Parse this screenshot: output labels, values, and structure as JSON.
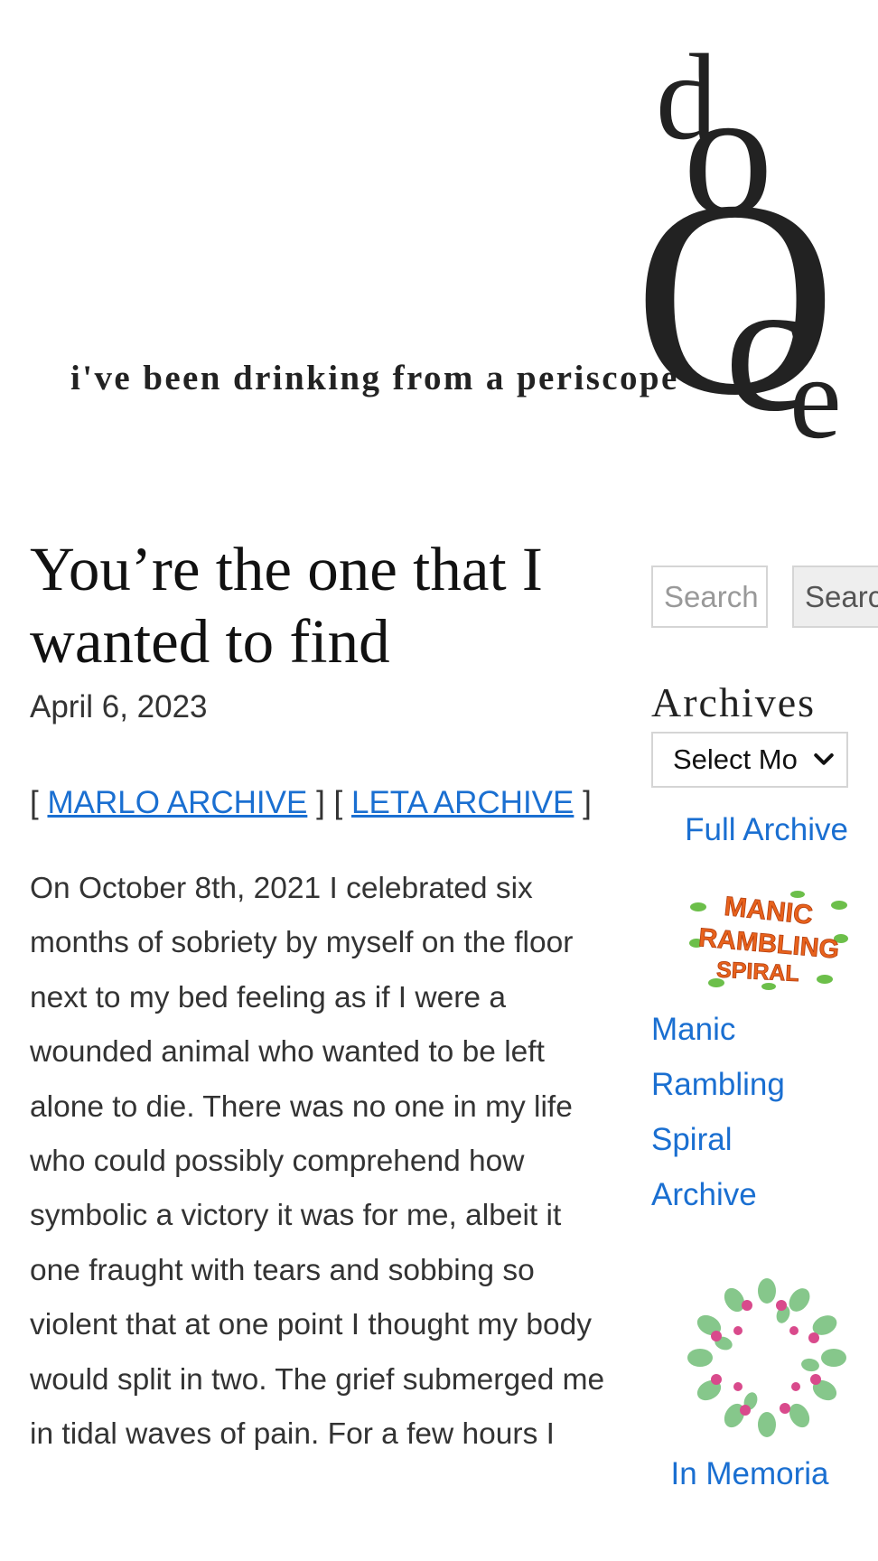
{
  "header": {
    "tagline": "i've been drinking from a periscope",
    "logo_letters": [
      "d",
      "o",
      "O",
      "c",
      "e"
    ]
  },
  "post": {
    "title": "You’re the one that I wanted to find",
    "date": "April 6, 2023",
    "archive_open": "[",
    "archive_mid": "] [",
    "archive_close": "]",
    "marlo_link": "MARLO ARCHIVE",
    "leta_link": "LETA ARCHIVE",
    "body": "On October 8th, 2021 I celebrated six months of sobriety by myself on the floor next to my bed feeling as if I were a wounded animal who wanted to be left alone to die. There was no one in my life who could possibly comprehend how symbolic a victory it was for me, albeit it one fraught with tears and sobbing so violent that at one point I thought my body would split in two. The grief submerged me in tidal waves of pain. For a few hours I"
  },
  "sidebar": {
    "search_placeholder": "Search",
    "search_button": "Search",
    "archives_title": "Archives",
    "archives_select": "Select Month",
    "full_archive": "Full Archive",
    "mrs_image_text": [
      "MANIC",
      "RAMBLING",
      "SPIRAL"
    ],
    "mrs_link": "Manic Rambling Spiral Archive",
    "memoriam_link": "In Memoria"
  },
  "colors": {
    "link": "#1a6fd1",
    "text": "#333333",
    "mrs_orange": "#e8621c",
    "leaf_green": "#5cb85c",
    "flower_pink": "#d94a8c"
  }
}
